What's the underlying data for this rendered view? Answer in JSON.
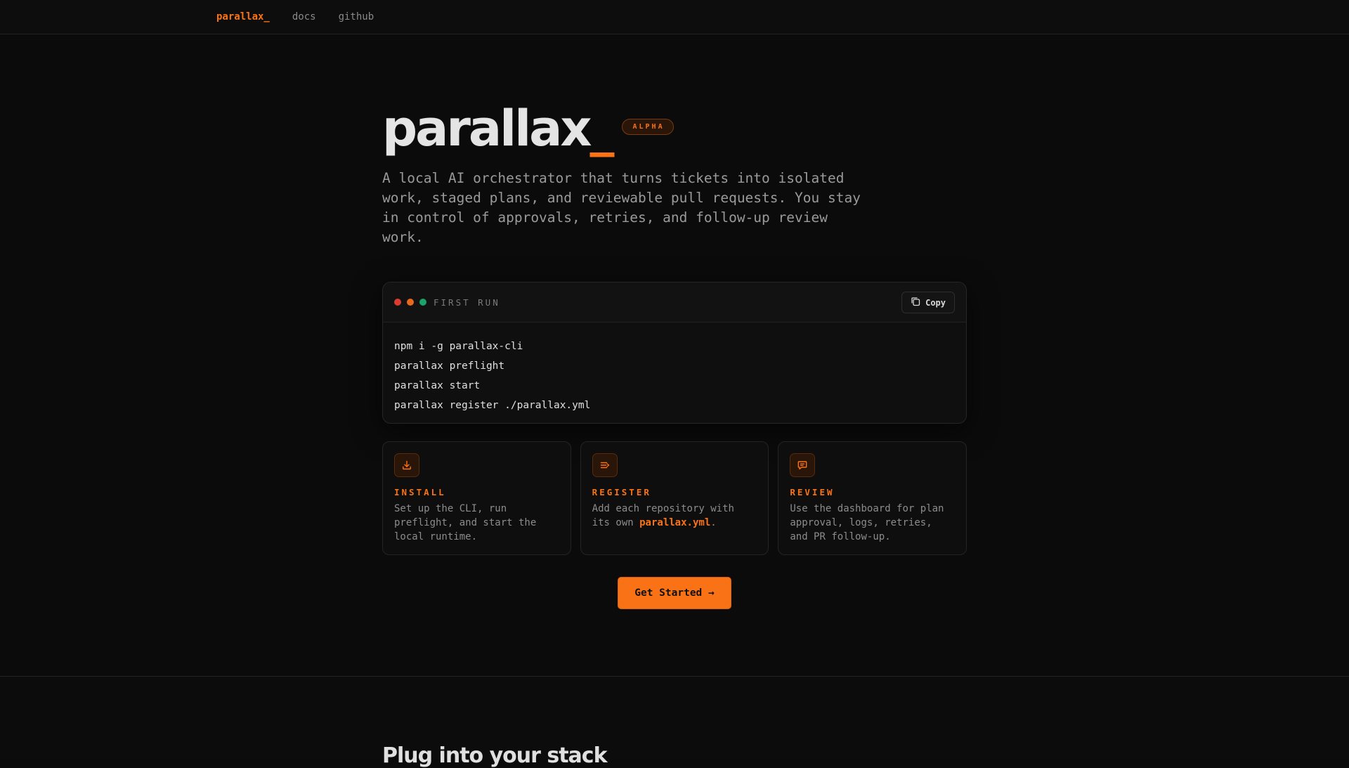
{
  "nav": {
    "brand": "parallax_",
    "links": [
      "docs",
      "github"
    ]
  },
  "hero": {
    "title": "parallax",
    "title_cursor": "_",
    "badge": "ALPHA",
    "description": "A local AI orchestrator that turns tickets into isolated work, staged plans, and reviewable pull requests. You stay in control of approvals, retries, and follow-up review work."
  },
  "terminal": {
    "label": "FIRST RUN",
    "copy_label": "Copy",
    "lines": [
      "npm i -g parallax-cli",
      "parallax preflight",
      "parallax start",
      "parallax register ./parallax.yml"
    ]
  },
  "cards": [
    {
      "icon": "download-icon",
      "title": "INSTALL",
      "text": "Set up the CLI, run preflight, and start the local runtime."
    },
    {
      "icon": "register-icon",
      "title": "REGISTER",
      "text_before": "Add each repository with its own ",
      "highlight": "parallax.yml",
      "text_after": "."
    },
    {
      "icon": "chat-icon",
      "title": "REVIEW",
      "text": "Use the dashboard for plan approval, logs, retries, and PR follow-up."
    }
  ],
  "cta": {
    "label": "Get Started →"
  },
  "section2": {
    "title": "Plug into your stack"
  },
  "colors": {
    "accent": "#f97316",
    "background": "#0b0b0b"
  }
}
